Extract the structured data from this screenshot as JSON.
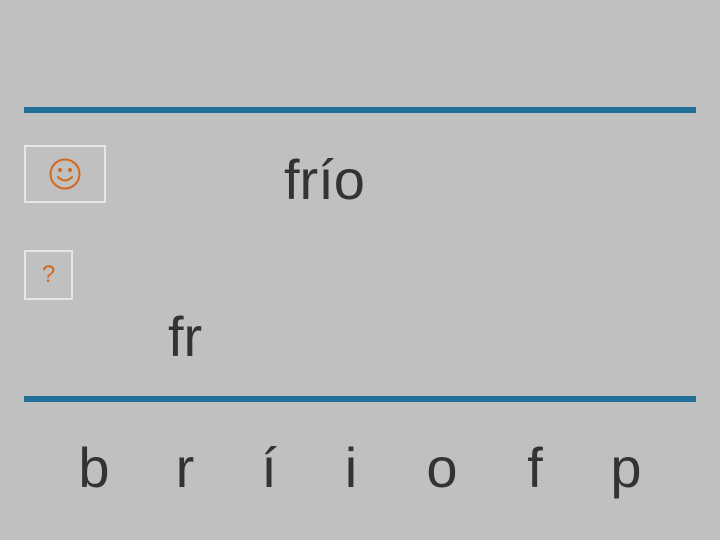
{
  "word": "frío",
  "answer_text": "fr",
  "help_label": "?",
  "tiles": [
    "b",
    "r",
    "í",
    "i",
    "o",
    "f",
    "p"
  ],
  "colors": {
    "background": "#c0c0c0",
    "rule": "#1f6f99",
    "box_border": "#e6e6e6",
    "icon": "#d2691e",
    "text": "#333333"
  },
  "icons": {
    "feedback": "smiley-icon"
  }
}
